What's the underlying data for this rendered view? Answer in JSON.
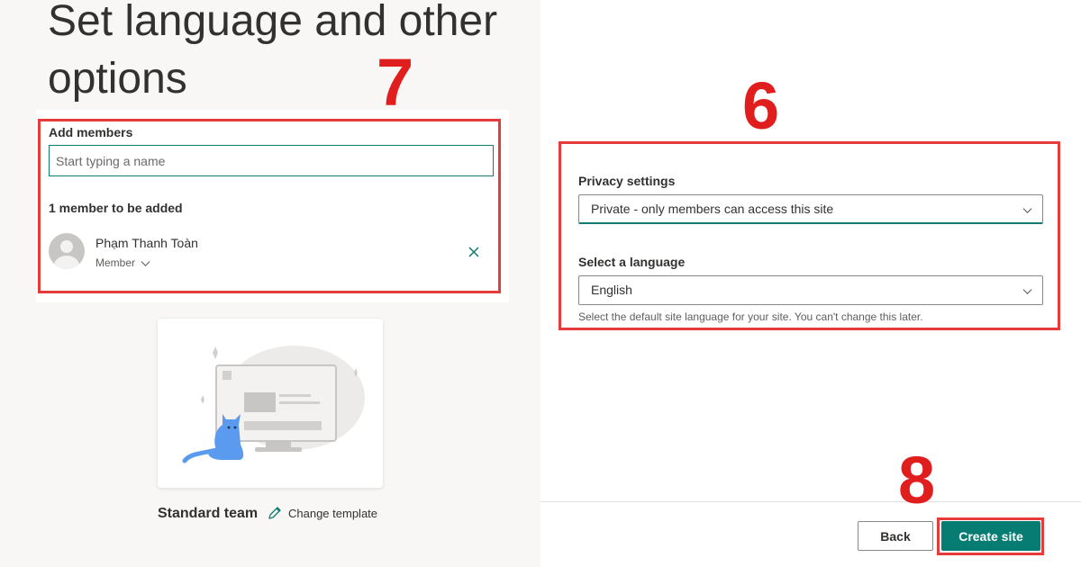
{
  "page": {
    "title": "Set language and other options"
  },
  "annotations": {
    "step_members": "7",
    "step_privacy": "6",
    "step_create": "8",
    "highlight_color": "#e63b3b"
  },
  "members": {
    "label": "Add members",
    "input_placeholder": "Start typing a name",
    "input_value": "",
    "count_label": "1 member to be added",
    "list": [
      {
        "name": "Phạm Thanh Toàn",
        "role": "Member",
        "avatar_icon": "person-avatar-icon"
      }
    ]
  },
  "template": {
    "name": "Standard team",
    "change_label": "Change template"
  },
  "privacy": {
    "label": "Privacy settings",
    "selected": "Private - only members can access this site"
  },
  "language": {
    "label": "Select a language",
    "selected": "English",
    "help": "Select the default site language for your site. You can't change this later."
  },
  "footer": {
    "back_label": "Back",
    "create_label": "Create site",
    "accent_color": "#077c72"
  }
}
